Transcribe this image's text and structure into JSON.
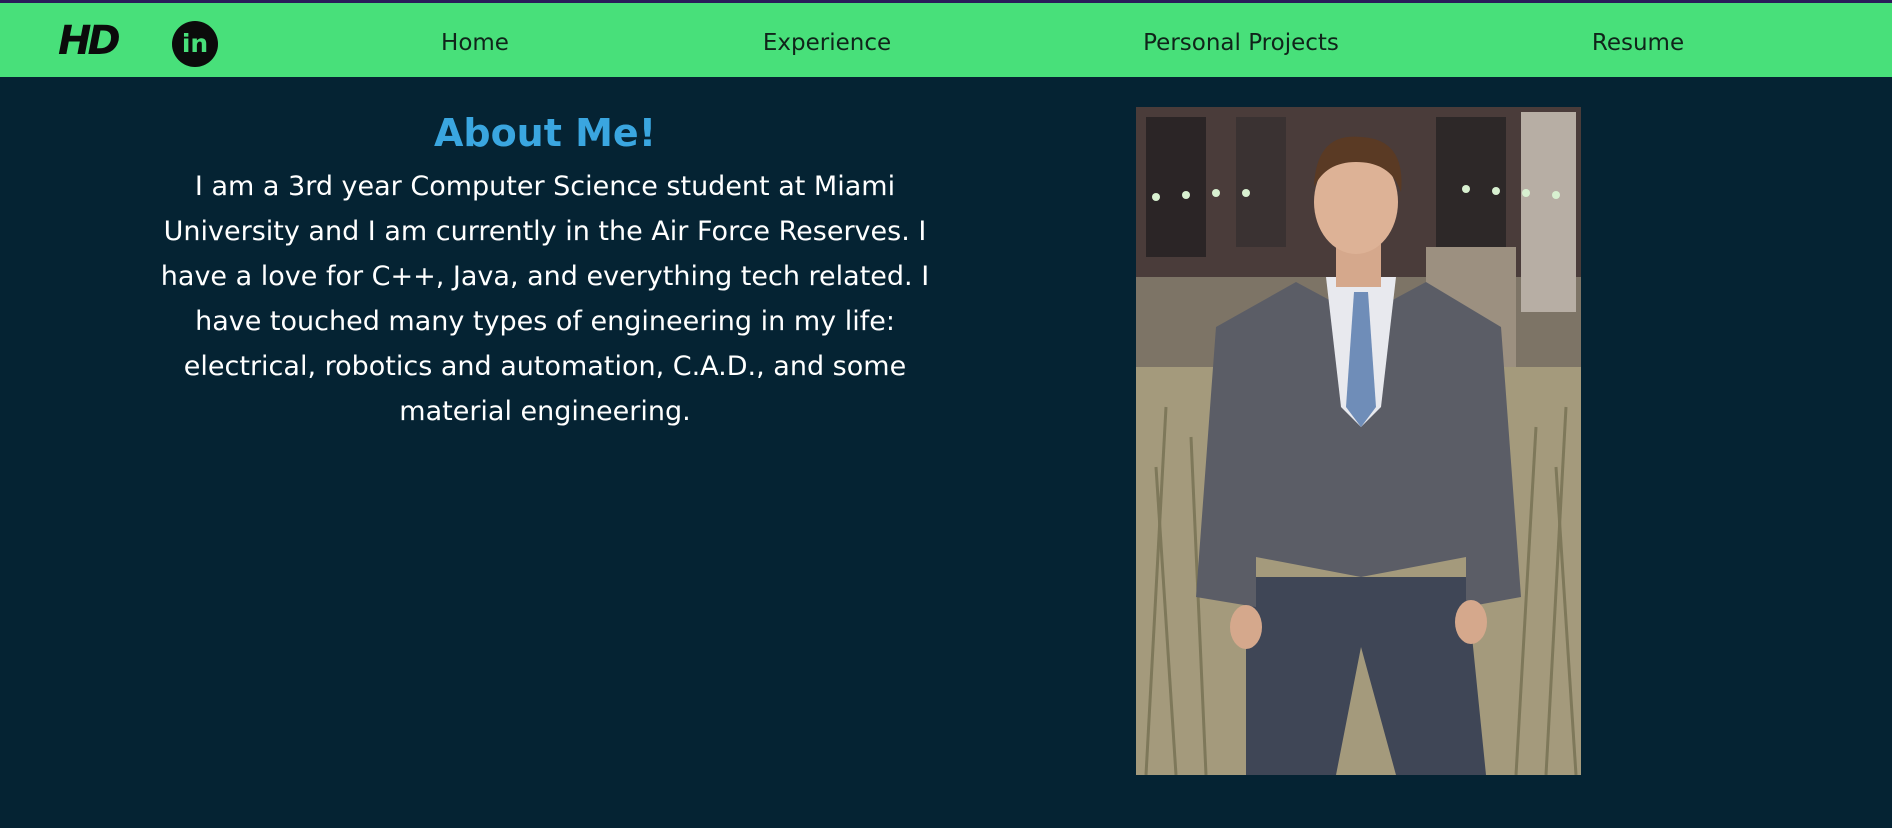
{
  "nav": {
    "logo_text": "HD",
    "linkedin_icon_text": "in",
    "links": [
      {
        "label": "Home"
      },
      {
        "label": "Experience"
      },
      {
        "label": "Personal Projects"
      },
      {
        "label": "Resume"
      }
    ]
  },
  "about": {
    "title": "About Me!",
    "body": "I am a 3rd year Computer Science student at Miami University and I am currently in the Air Force Reserves. I have a love for C++, Java, and everything tech related. I have touched many types of engineering in my life: electrical, robotics and automation, C.A.D., and some material engineering."
  },
  "colors": {
    "background": "#052333",
    "navbar": "#48e07a",
    "title": "#3aa6e0",
    "text": "#ffffff"
  },
  "icons": {
    "logo": "hd-logo-icon",
    "linkedin": "linkedin-icon"
  }
}
